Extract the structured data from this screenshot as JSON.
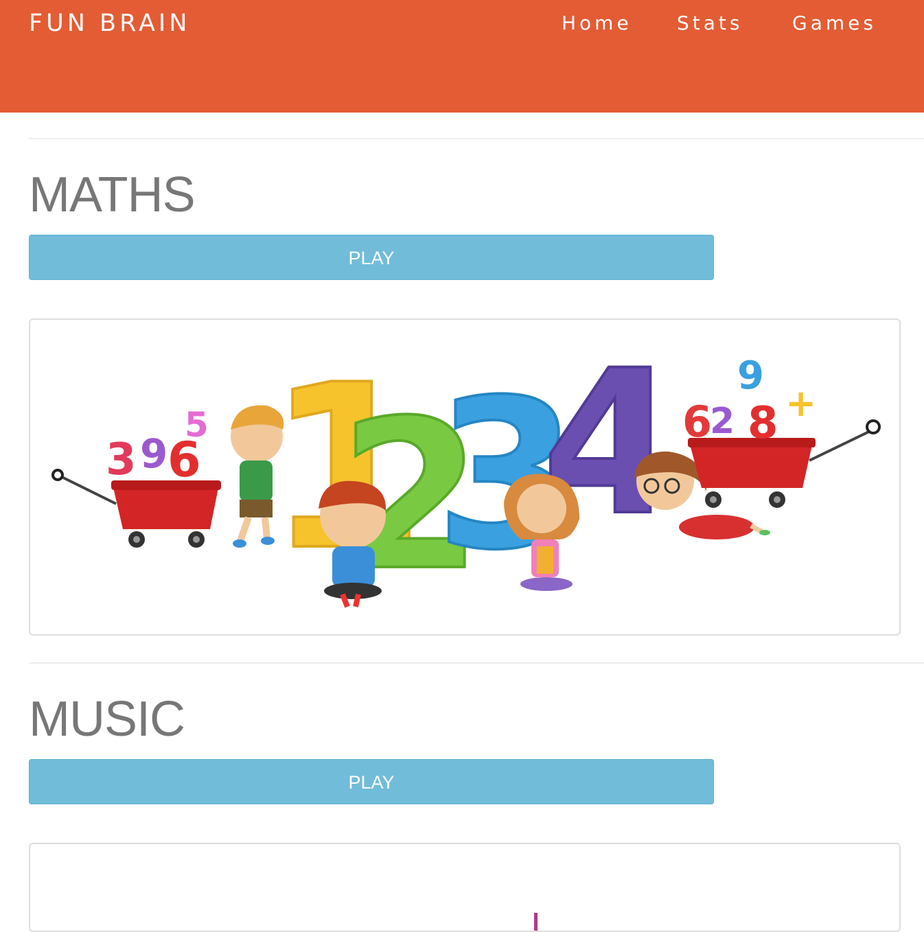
{
  "header": {
    "brand": "FUN BRAIN",
    "nav": [
      {
        "label": "Home"
      },
      {
        "label": "Stats"
      },
      {
        "label": "Games"
      }
    ]
  },
  "sections": [
    {
      "title": "MATHS",
      "play_label": "PLAY",
      "image": {
        "digits": [
          "1",
          "2",
          "3",
          "4"
        ],
        "left_cart_numbers": [
          "3",
          "9",
          "6",
          "5"
        ],
        "right_cart_numbers": [
          "6",
          "2",
          "8",
          "9",
          "+"
        ]
      }
    },
    {
      "title": "MUSIC",
      "play_label": "PLAY"
    }
  ],
  "colors": {
    "header_bg": "#e35c34",
    "button_bg": "#71bcd9",
    "title_gray": "#777777",
    "digit_yellow": "#f6c32c",
    "digit_green": "#7ac943",
    "digit_blue": "#3aa0e0",
    "digit_purple": "#6a4fb0",
    "cart_red": "#d32525"
  }
}
